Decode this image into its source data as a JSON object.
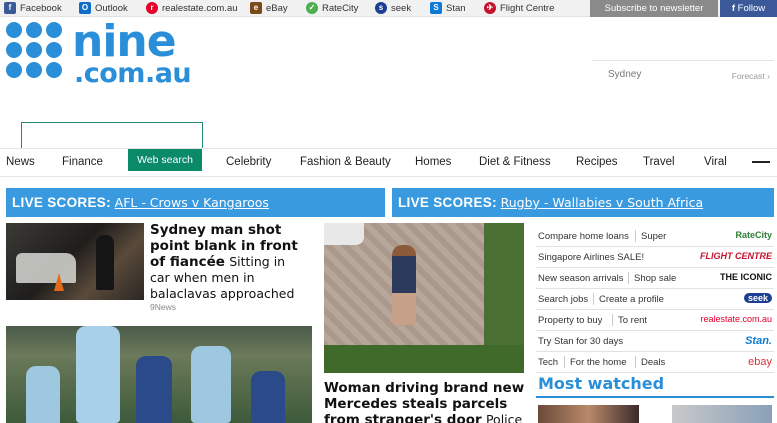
{
  "topbar": {
    "links": [
      {
        "label": "Facebook",
        "icon": "facebook-icon",
        "color": "#3b5998"
      },
      {
        "label": "Outlook",
        "icon": "outlook-icon",
        "color": "#0f6fc6"
      },
      {
        "label": "realestate.com.au",
        "icon": "realestate-icon",
        "color": "#e4002b"
      },
      {
        "label": "eBay",
        "icon": "ebay-icon",
        "color": "#7a4a1a"
      },
      {
        "label": "RateCity",
        "icon": "ratecity-icon",
        "color": "#4caf50"
      },
      {
        "label": "seek",
        "icon": "seek-icon",
        "color": "#1c3f94"
      },
      {
        "label": "Stan",
        "icon": "stan-icon",
        "color": "#0c7bd6"
      },
      {
        "label": "Flight Centre",
        "icon": "flight-centre-icon",
        "color": "#c8102e"
      }
    ],
    "subscribe": "Subscribe to newsletter",
    "follow": "Follow"
  },
  "logo": {
    "nine": "nine",
    "dom": ".com.au",
    "color": "#2a8fd8"
  },
  "weather": {
    "city": "Sydney",
    "forecast": "Forecast"
  },
  "search": {
    "button": "Web search",
    "placeholder": ""
  },
  "nav": [
    "News",
    "Finance",
    "Celebrity",
    "Fashion & Beauty",
    "Homes",
    "Diet & Fitness",
    "Recipes",
    "Travel",
    "Viral"
  ],
  "live_scores": [
    {
      "prefix": "LIVE SCORES:",
      "match": "AFL - Crows v Kangaroos"
    },
    {
      "prefix": "LIVE SCORES:",
      "match": "Rugby - Wallabies v South Africa"
    }
  ],
  "story1": {
    "headline": "Sydney man shot point blank in front of fiancée",
    "rest": "Sitting in car when men in balaclavas approached",
    "source": "9News"
  },
  "story2": {
    "headline": "Woman driving brand new Mercedes steals parcels from stranger's door",
    "rest": "Police"
  },
  "partners": [
    {
      "a": "Compare home loans",
      "b": "Super",
      "brand": "RateCity",
      "brand_color": "#2e7d32"
    },
    {
      "a": "Singapore Airlines SALE!",
      "b": "",
      "brand": "FLIGHT CENTRE",
      "brand_color": "#c8102e"
    },
    {
      "a": "New season arrivals",
      "b": "Shop sale",
      "brand": "THE ICONIC",
      "brand_color": "#111111"
    },
    {
      "a": "Search jobs",
      "b": "Create a profile",
      "brand": "seek",
      "brand_color": "#1c3f94"
    },
    {
      "a": "Property to buy",
      "b": "To rent",
      "brand": "realestate.com.au",
      "brand_color": "#e4002b"
    },
    {
      "a": "Try Stan for 30 days",
      "b": "",
      "brand": "Stan.",
      "brand_color": "#0c7bd6"
    },
    {
      "a": "Tech",
      "b": "For the home",
      "c": "Deals",
      "brand": "ebay",
      "brand_color": "#e53238"
    }
  ],
  "most_watched": "Most watched"
}
